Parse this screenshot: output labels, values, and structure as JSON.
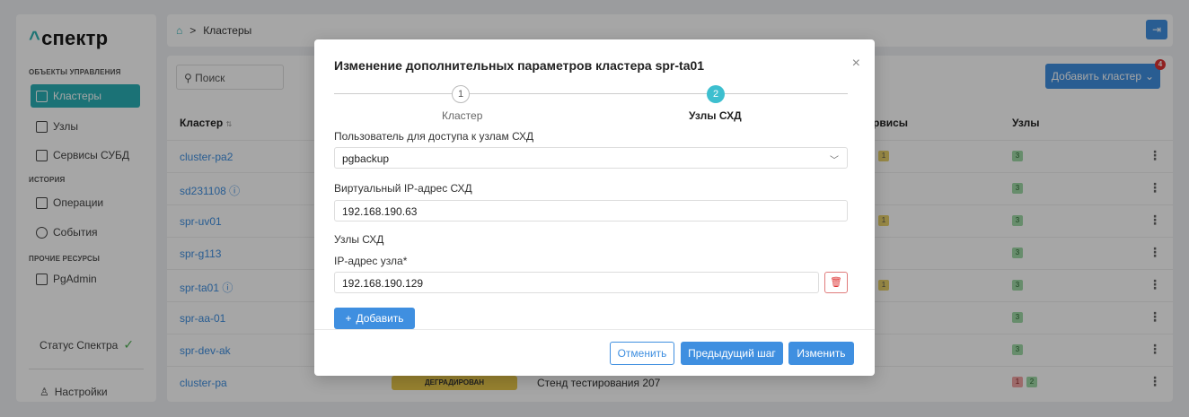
{
  "app": {
    "logo_caret": "^",
    "logo_text": "спектр"
  },
  "sidebar": {
    "section_management": "ОБЪЕКТЫ УПРАВЛЕНИЯ",
    "items": [
      {
        "label": "Кластеры",
        "icon": "cluster-icon",
        "active": true
      },
      {
        "label": "Узлы",
        "icon": "server-icon"
      },
      {
        "label": "Сервисы СУБД",
        "icon": "database-icon"
      }
    ],
    "section_history": "ИСТОРИЯ",
    "history_items": [
      {
        "label": "Операции",
        "icon": "operations-icon"
      },
      {
        "label": "События",
        "icon": "events-icon"
      }
    ],
    "section_other": "ПРОЧИЕ РЕСУРСЫ",
    "other_items": [
      {
        "label": "PgAdmin",
        "icon": "pgadmin-icon"
      }
    ],
    "status_label": "Статус Спектра",
    "status_icon": "check-icon",
    "settings_label": "Настройки"
  },
  "topbar": {
    "breadcrumb_home_icon": "home-icon",
    "breadcrumb_sep": ">",
    "breadcrumb_current": "Кластеры",
    "exit_icon": "exit-icon"
  },
  "main": {
    "search_placeholder": "Поиск",
    "add_cluster_label": "Добавить кластер",
    "add_cluster_badge": "4",
    "columns": {
      "cluster": "Кластер",
      "sort": "⇅",
      "services": "рвисы",
      "nodes": "Узлы"
    },
    "rows": [
      {
        "name": "cluster-pa2",
        "info": "",
        "svc": "1",
        "nodes": [
          "3"
        ]
      },
      {
        "name": "sd231108",
        "info": "ⓘ",
        "svc": "",
        "nodes": [
          "3"
        ]
      },
      {
        "name": "spr-uv01",
        "info": "",
        "svc": "1",
        "nodes": [
          "3"
        ]
      },
      {
        "name": "spr-g113",
        "info": "",
        "svc": "",
        "nodes": [
          "3"
        ]
      },
      {
        "name": "spr-ta01",
        "info": "ⓘ",
        "svc": "1",
        "nodes": [
          "3"
        ]
      },
      {
        "name": "spr-aa-01",
        "info": "",
        "svc": "",
        "nodes": [
          "3"
        ]
      },
      {
        "name": "spr-dev-ak",
        "info": "",
        "svc": "",
        "nodes": [
          "3"
        ]
      },
      {
        "name": "cluster-pa",
        "info": "",
        "svc": "",
        "status": "ДЕГРАДИРОВАН",
        "desc": "Стенд тестирования 207",
        "nodes": [
          "1",
          "2"
        ]
      }
    ]
  },
  "modal": {
    "title": "Изменение дополнительных параметров кластера spr-ta01",
    "close": "×",
    "steps": [
      {
        "num": "1",
        "label": "Кластер"
      },
      {
        "num": "2",
        "label": "Узлы СХД"
      }
    ],
    "user_label": "Пользователь для доступа к узлам СХД",
    "user_value": "pgbackup",
    "vip_label": "Виртуальный IP-адрес СХД",
    "vip_value": "192.168.190.63",
    "nodes_section": "Узлы СХД",
    "node_ip_label": "IP-адрес узла*",
    "node_ip_value": "192.168.190.129",
    "add_label": "Добавить",
    "cancel_label": "Отменить",
    "prev_label": "Предыдущий шаг",
    "apply_label": "Изменить"
  }
}
